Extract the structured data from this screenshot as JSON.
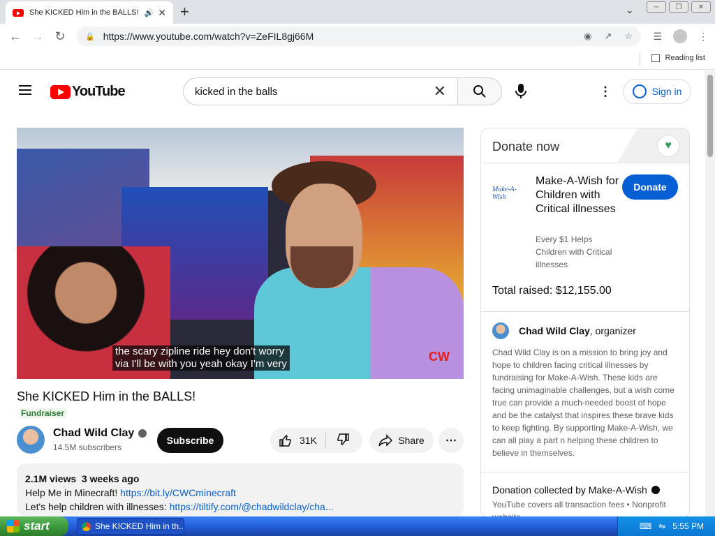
{
  "browser": {
    "tab_title": "She KICKED Him in the BALLS!",
    "url": "https://www.youtube.com/watch?v=ZeFIL8gj66M",
    "reading_list": "Reading list"
  },
  "youtube": {
    "logo_text": "YouTube",
    "search_query": "kicked in the balls",
    "signin_label": "Sign in"
  },
  "video": {
    "caption_line1": "the scary zipline ride hey don't worry",
    "caption_line2": "via I'll be with you yeah okay I'm very",
    "watermark": "CW",
    "title": "She KICKED Him in the BALLS!",
    "tag": "Fundraiser",
    "channel_name": "Chad Wild Clay",
    "subscribers": "14.5M subscribers",
    "subscribe_label": "Subscribe",
    "likes": "31K",
    "share_label": "Share",
    "views": "2.1M views",
    "age": "3 weeks ago",
    "desc_line1_prefix": "Help Me in Minecraft! ",
    "desc_line1_link": "https://bit.ly/CWCminecraft",
    "desc_line2_prefix": "Let's help children with illnesses: ",
    "desc_line2_link": "https://tiltify.com/@chadwildclay/cha..."
  },
  "donate": {
    "header": "Donate now",
    "org_logo_text": "Make-A-Wish",
    "org_name": "Make-A-Wish for Children with Critical illnesses",
    "org_tagline": "Every $1 Helps Children with Critical illnesses",
    "donate_label": "Donate",
    "total_raised": "Total raised: $12,155.00",
    "organizer_name": "Chad Wild Clay",
    "organizer_role": ", organizer",
    "bio": "Chad Wild Clay is on a mission to bring joy and hope to children facing critical illnesses by fundraising for Make-A-Wish. These kids are facing unimaginable challenges, but a wish come true can provide a much-needed boost of hope and be the catalyst that inspires these brave kids to keep fighting. By supporting Make-A-Wish, we can all play a part n helping these children to believe in themselves.",
    "collected_by": "Donation collected by Make-A-Wish",
    "fees_note": "YouTube covers all transaction fees  •  Nonprofit website"
  },
  "taskbar": {
    "start_label": "start",
    "task_title": "She KICKED Him in th...",
    "clock": "5:55 PM"
  },
  "colors": {
    "youtube_red": "#ff0000",
    "link_blue": "#065fd4",
    "xp_blue": "#245edb",
    "xp_green": "#3c9a3c"
  }
}
